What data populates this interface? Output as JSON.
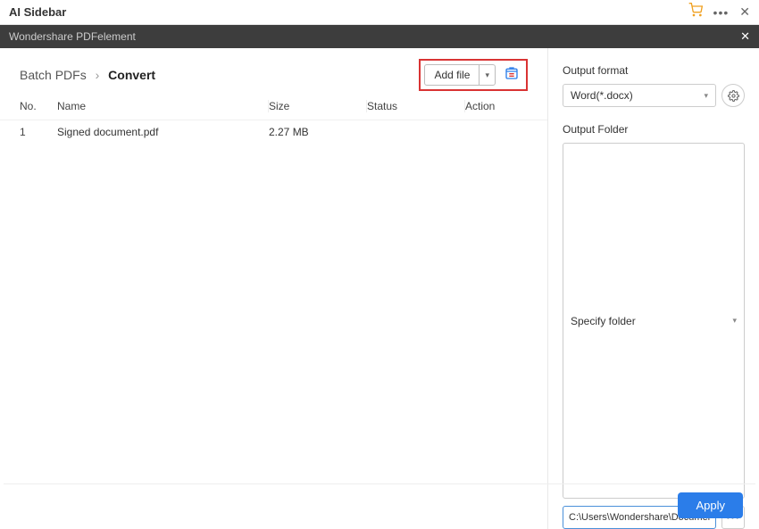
{
  "topBar": {
    "title": "AI Sidebar"
  },
  "subBar": {
    "title": "Wondershare PDFelement"
  },
  "breadcrumb": {
    "parent": "Batch PDFs",
    "current": "Convert"
  },
  "toolbar": {
    "addFile": "Add file"
  },
  "table": {
    "headers": {
      "no": "No.",
      "name": "Name",
      "size": "Size",
      "status": "Status",
      "action": "Action"
    },
    "rows": [
      {
        "no": "1",
        "name": "Signed document.pdf",
        "size": "2.27 MB",
        "status": "",
        "action": ""
      }
    ]
  },
  "rightPanel": {
    "outputFormatLabel": "Output format",
    "outputFormatValue": "Word(*.docx)",
    "outputFolderLabel": "Output Folder",
    "specifyFolderValue": "Specify folder",
    "pathValue": "C:\\Users\\Wondershare\\Documents\\"
  },
  "footer": {
    "apply": "Apply"
  }
}
